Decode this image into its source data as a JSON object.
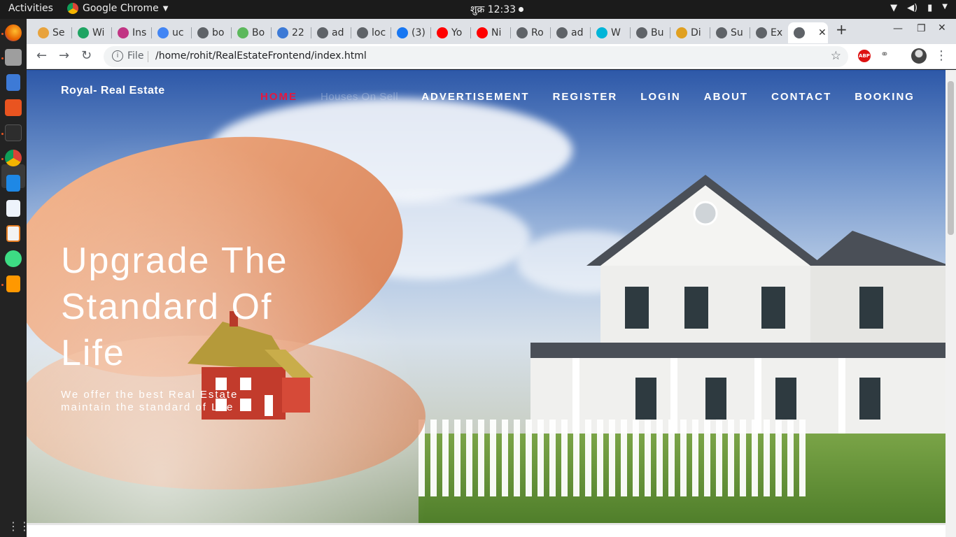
{
  "system": {
    "activities": "Activities",
    "app_name": "Google Chrome",
    "clock": "शुक्र 12:33"
  },
  "browser": {
    "tabs": [
      {
        "label": "Se",
        "icon": "tab-favicon",
        "color": "#e8a33d"
      },
      {
        "label": "Wi",
        "icon": "drive-icon",
        "color": "#1fa463"
      },
      {
        "label": "Ins",
        "icon": "instagram-icon",
        "color": "#c13584"
      },
      {
        "label": "uc",
        "icon": "google-icon",
        "color": "#4285f4"
      },
      {
        "label": "bo",
        "icon": "globe-icon",
        "color": "#5f6368"
      },
      {
        "label": "Bo",
        "icon": "tab-favicon",
        "color": "#5cb85c"
      },
      {
        "label": "22",
        "icon": "tab-favicon",
        "color": "#3d7ad6"
      },
      {
        "label": "ad",
        "icon": "globe-icon",
        "color": "#5f6368"
      },
      {
        "label": "loc",
        "icon": "globe-icon",
        "color": "#5f6368"
      },
      {
        "label": "(3)",
        "icon": "facebook-icon",
        "color": "#1877f2"
      },
      {
        "label": "Yo",
        "icon": "youtube-icon",
        "color": "#ff0000"
      },
      {
        "label": "Ni",
        "icon": "youtube-icon",
        "color": "#ff0000"
      },
      {
        "label": "Ro",
        "icon": "globe-icon",
        "color": "#5f6368"
      },
      {
        "label": "ad",
        "icon": "globe-icon",
        "color": "#5f6368"
      },
      {
        "label": "W",
        "icon": "play-icon",
        "color": "#00b5d8"
      },
      {
        "label": "Bu",
        "icon": "globe-icon",
        "color": "#5f6368"
      },
      {
        "label": "Di",
        "icon": "tab-favicon",
        "color": "#e0a020"
      },
      {
        "label": "Su",
        "icon": "lock-icon",
        "color": "#5f6368"
      },
      {
        "label": "Ex",
        "icon": "globe-icon",
        "color": "#5f6368"
      }
    ],
    "active_tab_close": "✕",
    "address": {
      "scheme": "File",
      "url": "/home/rohit/RealEstateFrontend/index.html"
    },
    "extension_abp": "ABP"
  },
  "site": {
    "brand": "Royal- Real Estate",
    "nav": [
      "HOME",
      "Houses On Sell",
      "ADVERTISEMENT",
      "REGISTER",
      "LOGIN",
      "ABOUT",
      "CONTACT",
      "BOOKING"
    ],
    "headline": "Upgrade The Standard Of Life",
    "subtext": "We offer the best Real Estate maintain the standard of Life",
    "accent": "#e5173f"
  }
}
